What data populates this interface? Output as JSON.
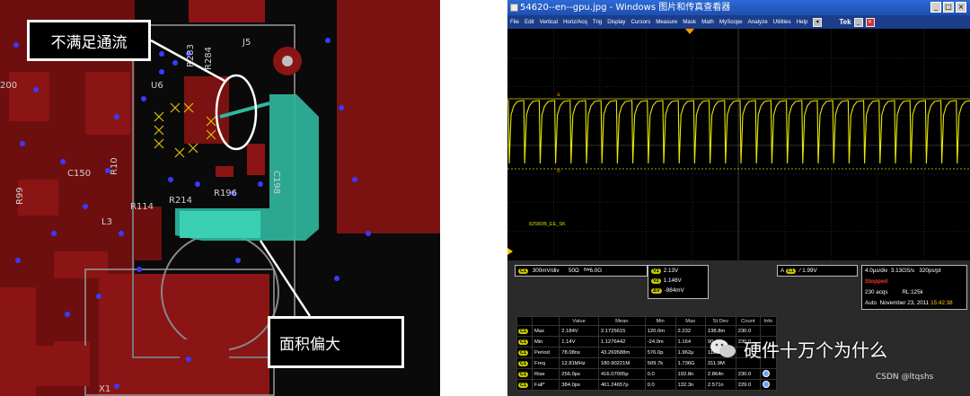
{
  "pcb": {
    "callout_top": "不满足通流",
    "callout_bottom": "面积偏大",
    "refdes": [
      "R283",
      "R284",
      "J5",
      "U6",
      "C198",
      "C150",
      "R10",
      "R99",
      "R114",
      "R214",
      "R196",
      "L3",
      "X1",
      "200"
    ]
  },
  "scope": {
    "title": "54620--en--gpu.jpg - Windows 图片和传真查看器",
    "menu": [
      "File",
      "Edit",
      "Vertical",
      "Horiz/Acq",
      "Trig",
      "Display",
      "Cursors",
      "Measure",
      "Mask",
      "Math",
      "MyScope",
      "Analyze",
      "Utilities",
      "Help"
    ],
    "brand": "Tek",
    "trace_label": "8258DB_EE_SK",
    "channel": {
      "badge": "C1",
      "scale": "300mV/div",
      "impedance": "50Ω",
      "bw": "6.0G"
    },
    "cursors": [
      {
        "badge": "V1",
        "value": "2.13V"
      },
      {
        "badge": "V2",
        "value": "1.146V"
      },
      {
        "badge": "ΔV",
        "value": "-984mV"
      }
    ],
    "trigger": {
      "badge": "C1",
      "level": "1.99V"
    },
    "timebase": {
      "div": "4.0µs/div",
      "rate": "3.13GS/s",
      "res": "320ps/pt",
      "state": "Stopped",
      "acqs": "230 acqs",
      "rl": "RL:125k",
      "mode": "Auto",
      "date": "November 23, 2011",
      "time": "15:42:38"
    },
    "meas_headers": [
      "",
      "",
      "Value",
      "Mean",
      "Min",
      "Max",
      "St Dev",
      "Count",
      "Info"
    ],
    "meas_rows": [
      {
        "badge": "C1",
        "name": "Max",
        "value": "2.184V",
        "mean": "2.1725615",
        "min": "120.0m",
        "max": "2.232",
        "stdev": "138.8m",
        "count": "230.0"
      },
      {
        "badge": "C1",
        "name": "Min",
        "value": "1.14V",
        "mean": "1.1276442",
        "min": "-24.0m",
        "max": "1.164",
        "stdev": "90.4m",
        "count": "230.0"
      },
      {
        "badge": "C1",
        "name": "Period",
        "value": "78.08ns",
        "mean": "43.269588m",
        "min": "576.0p",
        "max": "1.962µ",
        "stdev": "110",
        "count": ""
      },
      {
        "badge": "C1",
        "name": "Freq",
        "value": "12.81MHz",
        "mean": "180.90221M",
        "min": "509.7k",
        "max": "1.736G",
        "stdev": "311.9M",
        "count": ""
      },
      {
        "badge": "C1",
        "name": "Rise",
        "value": "256.0ps",
        "mean": "416.07005p",
        "min": "0.0",
        "max": "192.8n",
        "stdev": "2.864n",
        "count": "230.0"
      },
      {
        "badge": "C1",
        "name": "Fall*",
        "value": "384.0ps",
        "mean": "461.24657p",
        "min": "0.0",
        "max": "132.3n",
        "stdev": "2.571n",
        "count": "229.0"
      }
    ],
    "watermark": "硬件十万个为什么",
    "csdn": "CSDN @ltqshs"
  },
  "colors": {
    "pcb_copper": "#8b1414",
    "pcb_trace": "#30b8a0",
    "scope_trace": "#e8e800",
    "menu_bg": "#1b3d8a",
    "title_bg": "#2c6bd6"
  }
}
